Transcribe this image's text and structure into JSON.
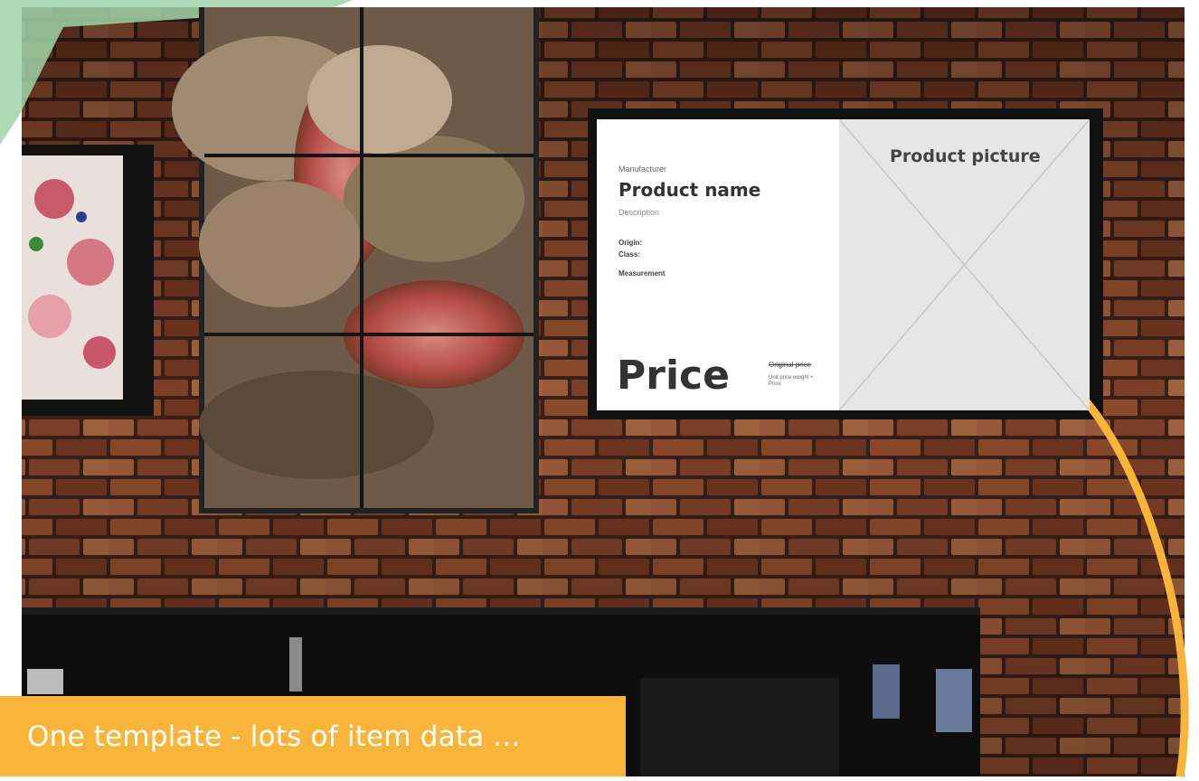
{
  "overlay": {
    "caption": "One template - lots of item data ..."
  },
  "price_screen": {
    "manufacturer": "Manufacturer",
    "product_name": "Product name",
    "description": "Description",
    "origin": "Origin:",
    "class": "Class:",
    "measurement": "Measurement",
    "price": "Price",
    "original_price": "Original price",
    "unit_price": "Unit price weight + Price",
    "product_picture": "Product picture"
  },
  "colors": {
    "accent_orange": "#f8b53a",
    "brick": "#7a3a22",
    "teal_corner": "#9fd4a8"
  }
}
